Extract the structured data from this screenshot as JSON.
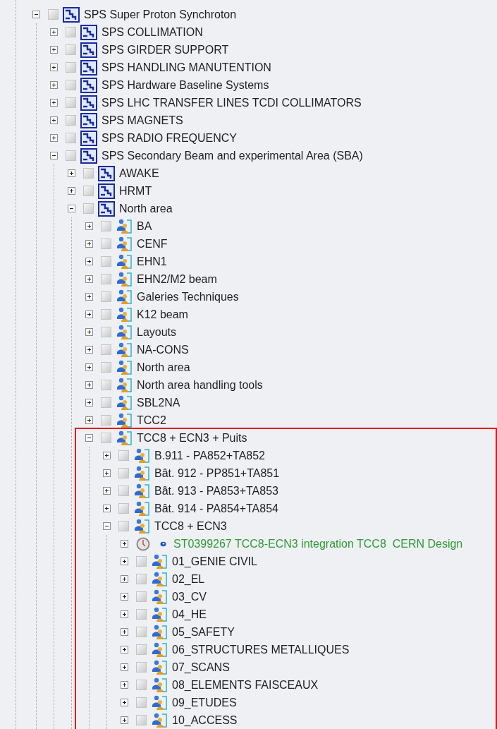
{
  "tree": {
    "nodes": [
      {
        "label": "SPS Super Proton Synchroton",
        "kind": "assembly",
        "checked": false,
        "expanded": true,
        "children": [
          {
            "label": "SPS COLLIMATION",
            "kind": "assembly",
            "checked": false,
            "expanded": false
          },
          {
            "label": "SPS GIRDER SUPPORT",
            "kind": "assembly",
            "checked": false,
            "expanded": false
          },
          {
            "label": "SPS HANDLING MANUTENTION",
            "kind": "assembly",
            "checked": false,
            "expanded": false
          },
          {
            "label": "SPS Hardware Baseline Systems",
            "kind": "assembly",
            "checked": false,
            "expanded": false
          },
          {
            "label": "SPS LHC TRANSFER LINES TCDI COLLIMATORS",
            "kind": "assembly",
            "checked": false,
            "expanded": false
          },
          {
            "label": "SPS MAGNETS",
            "kind": "assembly",
            "checked": false,
            "expanded": false
          },
          {
            "label": "SPS RADIO FREQUENCY",
            "kind": "assembly",
            "checked": false,
            "expanded": false
          },
          {
            "label": "SPS Secondary Beam and experimental Area (SBA)",
            "kind": "assembly",
            "checked": false,
            "expanded": true,
            "children": [
              {
                "label": "AWAKE",
                "kind": "assembly",
                "checked": false,
                "expanded": false
              },
              {
                "label": "HRMT",
                "kind": "assembly",
                "checked": false,
                "expanded": false
              },
              {
                "label": "North area",
                "kind": "assembly",
                "checked": false,
                "expanded": true,
                "children": [
                  {
                    "label": "BA",
                    "kind": "group",
                    "checked": false,
                    "expanded": false
                  },
                  {
                    "label": "CENF",
                    "kind": "group",
                    "checked": false,
                    "expanded": false
                  },
                  {
                    "label": "EHN1",
                    "kind": "group",
                    "checked": false,
                    "expanded": false
                  },
                  {
                    "label": "EHN2/M2 beam",
                    "kind": "group",
                    "checked": false,
                    "expanded": false
                  },
                  {
                    "label": "Galeries Techniques",
                    "kind": "group",
                    "checked": false,
                    "expanded": false
                  },
                  {
                    "label": "K12 beam",
                    "kind": "group",
                    "checked": false,
                    "expanded": false
                  },
                  {
                    "label": "Layouts",
                    "kind": "group",
                    "checked": false,
                    "expanded": false
                  },
                  {
                    "label": "NA-CONS",
                    "kind": "group",
                    "checked": false,
                    "expanded": false
                  },
                  {
                    "label": "North area",
                    "kind": "group",
                    "checked": false,
                    "expanded": false
                  },
                  {
                    "label": "North area handling tools",
                    "kind": "group",
                    "checked": false,
                    "expanded": false
                  },
                  {
                    "label": "SBL2NA",
                    "kind": "group",
                    "checked": false,
                    "expanded": false
                  },
                  {
                    "label": "TCC2",
                    "kind": "group",
                    "checked": false,
                    "expanded": false
                  },
                  {
                    "label": "TCC8 + ECN3 + Puits",
                    "kind": "group",
                    "checked": false,
                    "expanded": true,
                    "highlighted": true,
                    "children": [
                      {
                        "label": "B.911 - PA852+TA852",
                        "kind": "group",
                        "checked": false,
                        "expanded": false
                      },
                      {
                        "label": "Bât. 912 - PP851+TA851",
                        "kind": "group",
                        "checked": false,
                        "expanded": false
                      },
                      {
                        "label": "Bât. 913 - PA853+TA853",
                        "kind": "group",
                        "checked": false,
                        "expanded": false
                      },
                      {
                        "label": "Bât. 914 - PA854+TA854",
                        "kind": "group",
                        "checked": false,
                        "expanded": false
                      },
                      {
                        "label": "TCC8 + ECN3",
                        "kind": "group",
                        "checked": false,
                        "expanded": true,
                        "children": [
                          {
                            "label": "ST0399267 TCC8-ECN3 integration TCC8  CERN Design",
                            "kind": "document",
                            "expanded": false
                          },
                          {
                            "label": "01_GENIE CIVIL",
                            "kind": "group",
                            "checked": false,
                            "expanded": false
                          },
                          {
                            "label": "02_EL",
                            "kind": "group",
                            "checked": false,
                            "expanded": false
                          },
                          {
                            "label": "03_CV",
                            "kind": "group",
                            "checked": false,
                            "expanded": false
                          },
                          {
                            "label": "04_HE",
                            "kind": "group",
                            "checked": false,
                            "expanded": false
                          },
                          {
                            "label": "05_SAFETY",
                            "kind": "group",
                            "checked": false,
                            "expanded": false
                          },
                          {
                            "label": "06_STRUCTURES METALLIQUES",
                            "kind": "group",
                            "checked": false,
                            "expanded": false
                          },
                          {
                            "label": "07_SCANS",
                            "kind": "group",
                            "checked": false,
                            "expanded": false
                          },
                          {
                            "label": "08_ELEMENTS FAISCEAUX",
                            "kind": "group",
                            "checked": false,
                            "expanded": false
                          },
                          {
                            "label": "09_ETUDES",
                            "kind": "group",
                            "checked": false,
                            "expanded": false
                          },
                          {
                            "label": "10_ACCESS",
                            "kind": "group",
                            "checked": false,
                            "expanded": false
                          }
                        ]
                      }
                    ]
                  }
                ]
              }
            ]
          }
        ]
      }
    ]
  }
}
